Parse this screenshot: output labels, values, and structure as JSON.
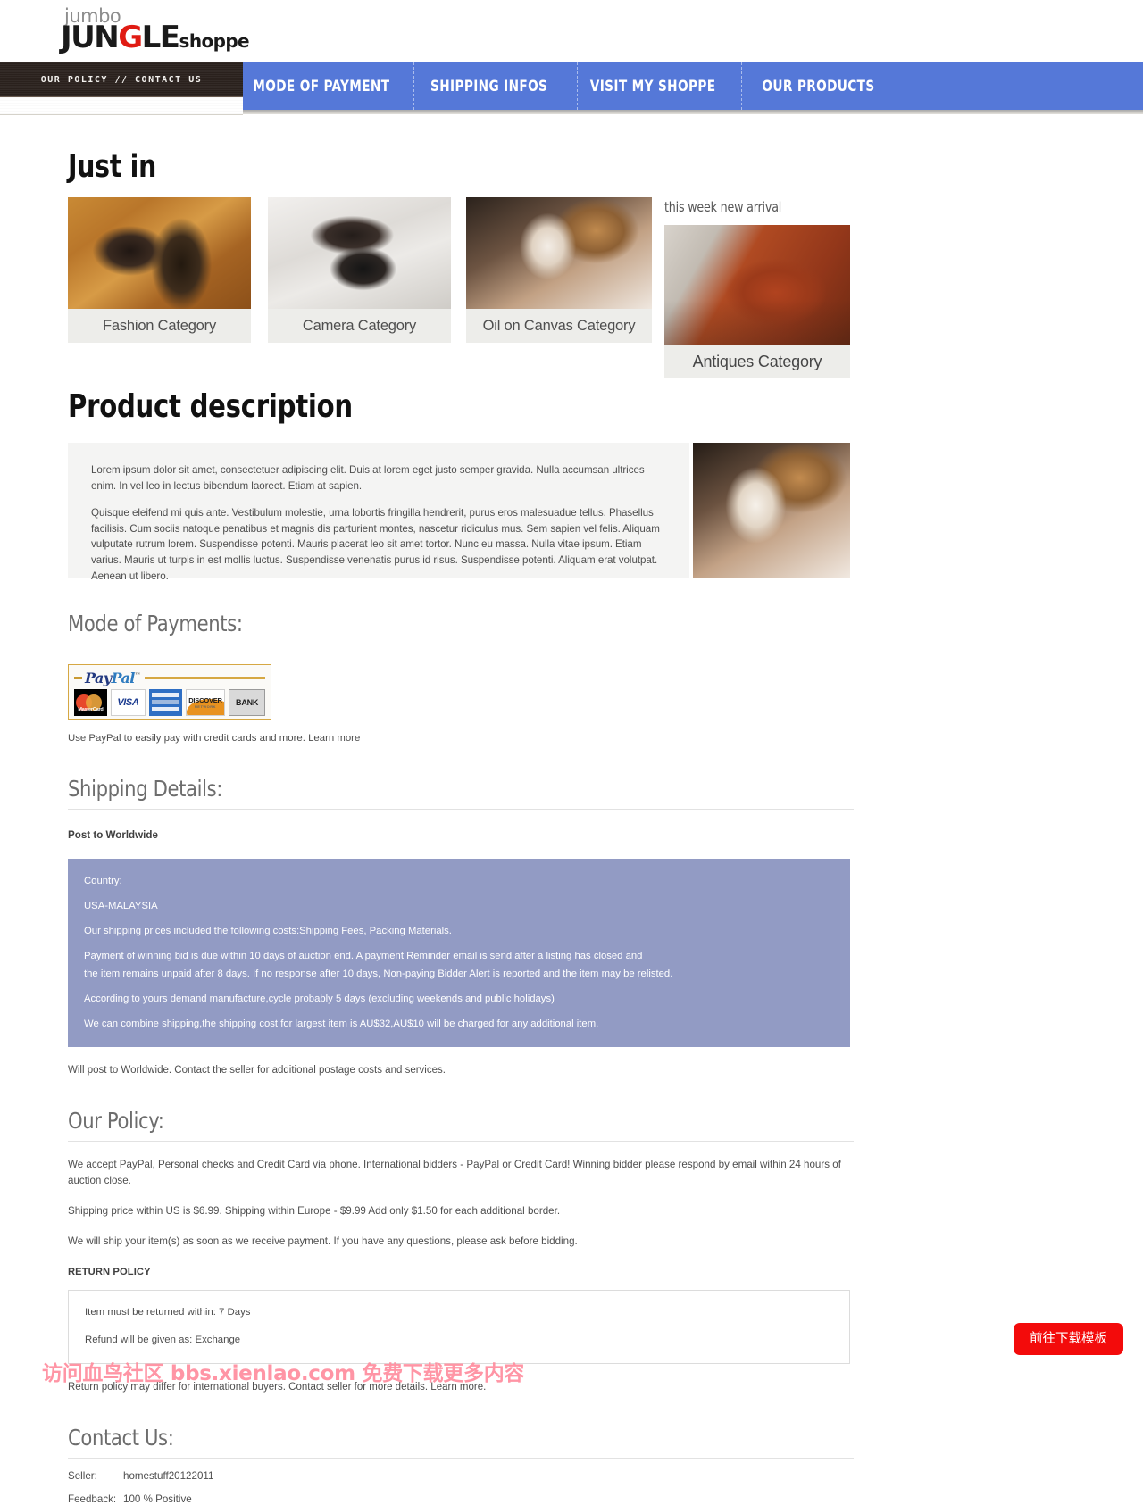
{
  "brand": {
    "top_word": "jumbo",
    "main_left": "JUN",
    "main_g": "G",
    "main_right": "LE",
    "suffix": "shoppe"
  },
  "nav": {
    "policy_tab": "OUR POLICY // CONTACT US",
    "accent_color": "#5578d8",
    "items": [
      {
        "label": "MODE OF PAYMENT"
      },
      {
        "label": "SHIPPING INFOS"
      },
      {
        "label": "VISIT MY SHOPPE"
      },
      {
        "label": "OUR PRODUCTS"
      }
    ]
  },
  "just_in": {
    "title": "Just in",
    "arrival_label": "this week new arrival",
    "categories": [
      {
        "caption": "Fashion Category",
        "image": "sandals-photo"
      },
      {
        "caption": "Camera Category",
        "image": "dslr-camera-photo"
      },
      {
        "caption": "Oil on Canvas Category",
        "image": "kitten-photo"
      },
      {
        "caption": "Antiques Category",
        "image": "antique-chest-photo"
      }
    ]
  },
  "product_description": {
    "title": "Product description",
    "paragraphs": [
      "Lorem ipsum dolor sit amet, consectetuer adipiscing elit. Duis at lorem eget justo semper gravida. Nulla accumsan ultrices enim. In vel leo in lectus bibendum laoreet. Etiam at sapien.",
      "Quisque eleifend mi quis ante. Vestibulum molestie, urna lobortis fringilla hendrerit, purus eros malesuadue tellus. Phasellus facilisis. Cum sociis natoque penatibus et magnis dis parturient montes, nascetur ridiculus mus. Sem sapien vel felis. Aliquam vulputate rutrum lorem. Suspendisse potenti. Mauris placerat leo sit amet tortor. Nunc eu massa. Nulla vitae ipsum. Etiam varius. Mauris ut turpis in est mollis luctus. Suspendisse venenatis purus id risus. Suspendisse potenti. Aliquam erat volutpat. Aenean ut libero."
    ],
    "image": "kitten-photo"
  },
  "payments": {
    "title": "Mode of Payments:",
    "paypal_word_pay": "Pay",
    "paypal_word_pal": "Pal",
    "paypal_tm": "™",
    "cards": [
      {
        "name": "MasterCard",
        "label": "MasterCard"
      },
      {
        "name": "VISA",
        "label": "VISA"
      },
      {
        "name": "American Express",
        "label": ""
      },
      {
        "name": "DISCOVER",
        "label": "DISCOVER",
        "sub": "NETWORK"
      },
      {
        "name": "BANK",
        "label": "BANK"
      }
    ],
    "note": "Use PayPal to easily pay with credit cards and more. Learn more"
  },
  "shipping": {
    "title": "Shipping Details:",
    "post_to": "Post to Worldwide",
    "block_color": "#929bc4",
    "block_lines": [
      "Country:",
      "USA-MALAYSIA",
      "Our shipping prices included the following costs:Shipping Fees, Packing Materials.",
      "Payment of winning bid is due within 10 days of auction end. A payment Reminder email is send after a listing has closed and",
      "the item remains unpaid after 8 days. If no response after 10 days, Non-paying Bidder Alert is reported and the item may be relisted.",
      "According to yours demand manufacture,cycle probably 5 days (excluding weekends and public holidays)",
      "We can combine shipping,the shipping cost for largest item is AU$32,AU$10 will be charged for any additional item."
    ],
    "after_note": "Will post to Worldwide. Contact the seller for additional postage costs and services."
  },
  "policy": {
    "title": "Our Policy:",
    "paragraphs": [
      "We accept PayPal, Personal checks and Credit Card via phone. International bidders - PayPal or Credit Card! Winning bidder please respond by email within 24 hours of auction close.",
      "Shipping price within US is $6.99. Shipping within Europe - $9.99 Add only $1.50 for each additional border.",
      "We will ship your item(s) as soon as we receive payment. If you have any questions, please ask before bidding."
    ],
    "return_heading": "RETURN POLICY",
    "return_lines": [
      "Item must be returned within: 7 Days",
      "Refund will be given as: Exchange"
    ],
    "return_note": "Return policy may differ for international buyers. Contact seller for more details. Learn more."
  },
  "contact": {
    "title": "Contact Us:",
    "seller_label": "Seller:",
    "seller_value": "homestuff20122011",
    "feedback_label": "Feedback:",
    "feedback_value": "100 % Positive"
  },
  "overlay": {
    "watermark": "访问血鸟社区 bbs.xienlao.com 免费下载更多内容",
    "download_button": "前往下载模板",
    "download_button_color": "#f30b0b"
  }
}
